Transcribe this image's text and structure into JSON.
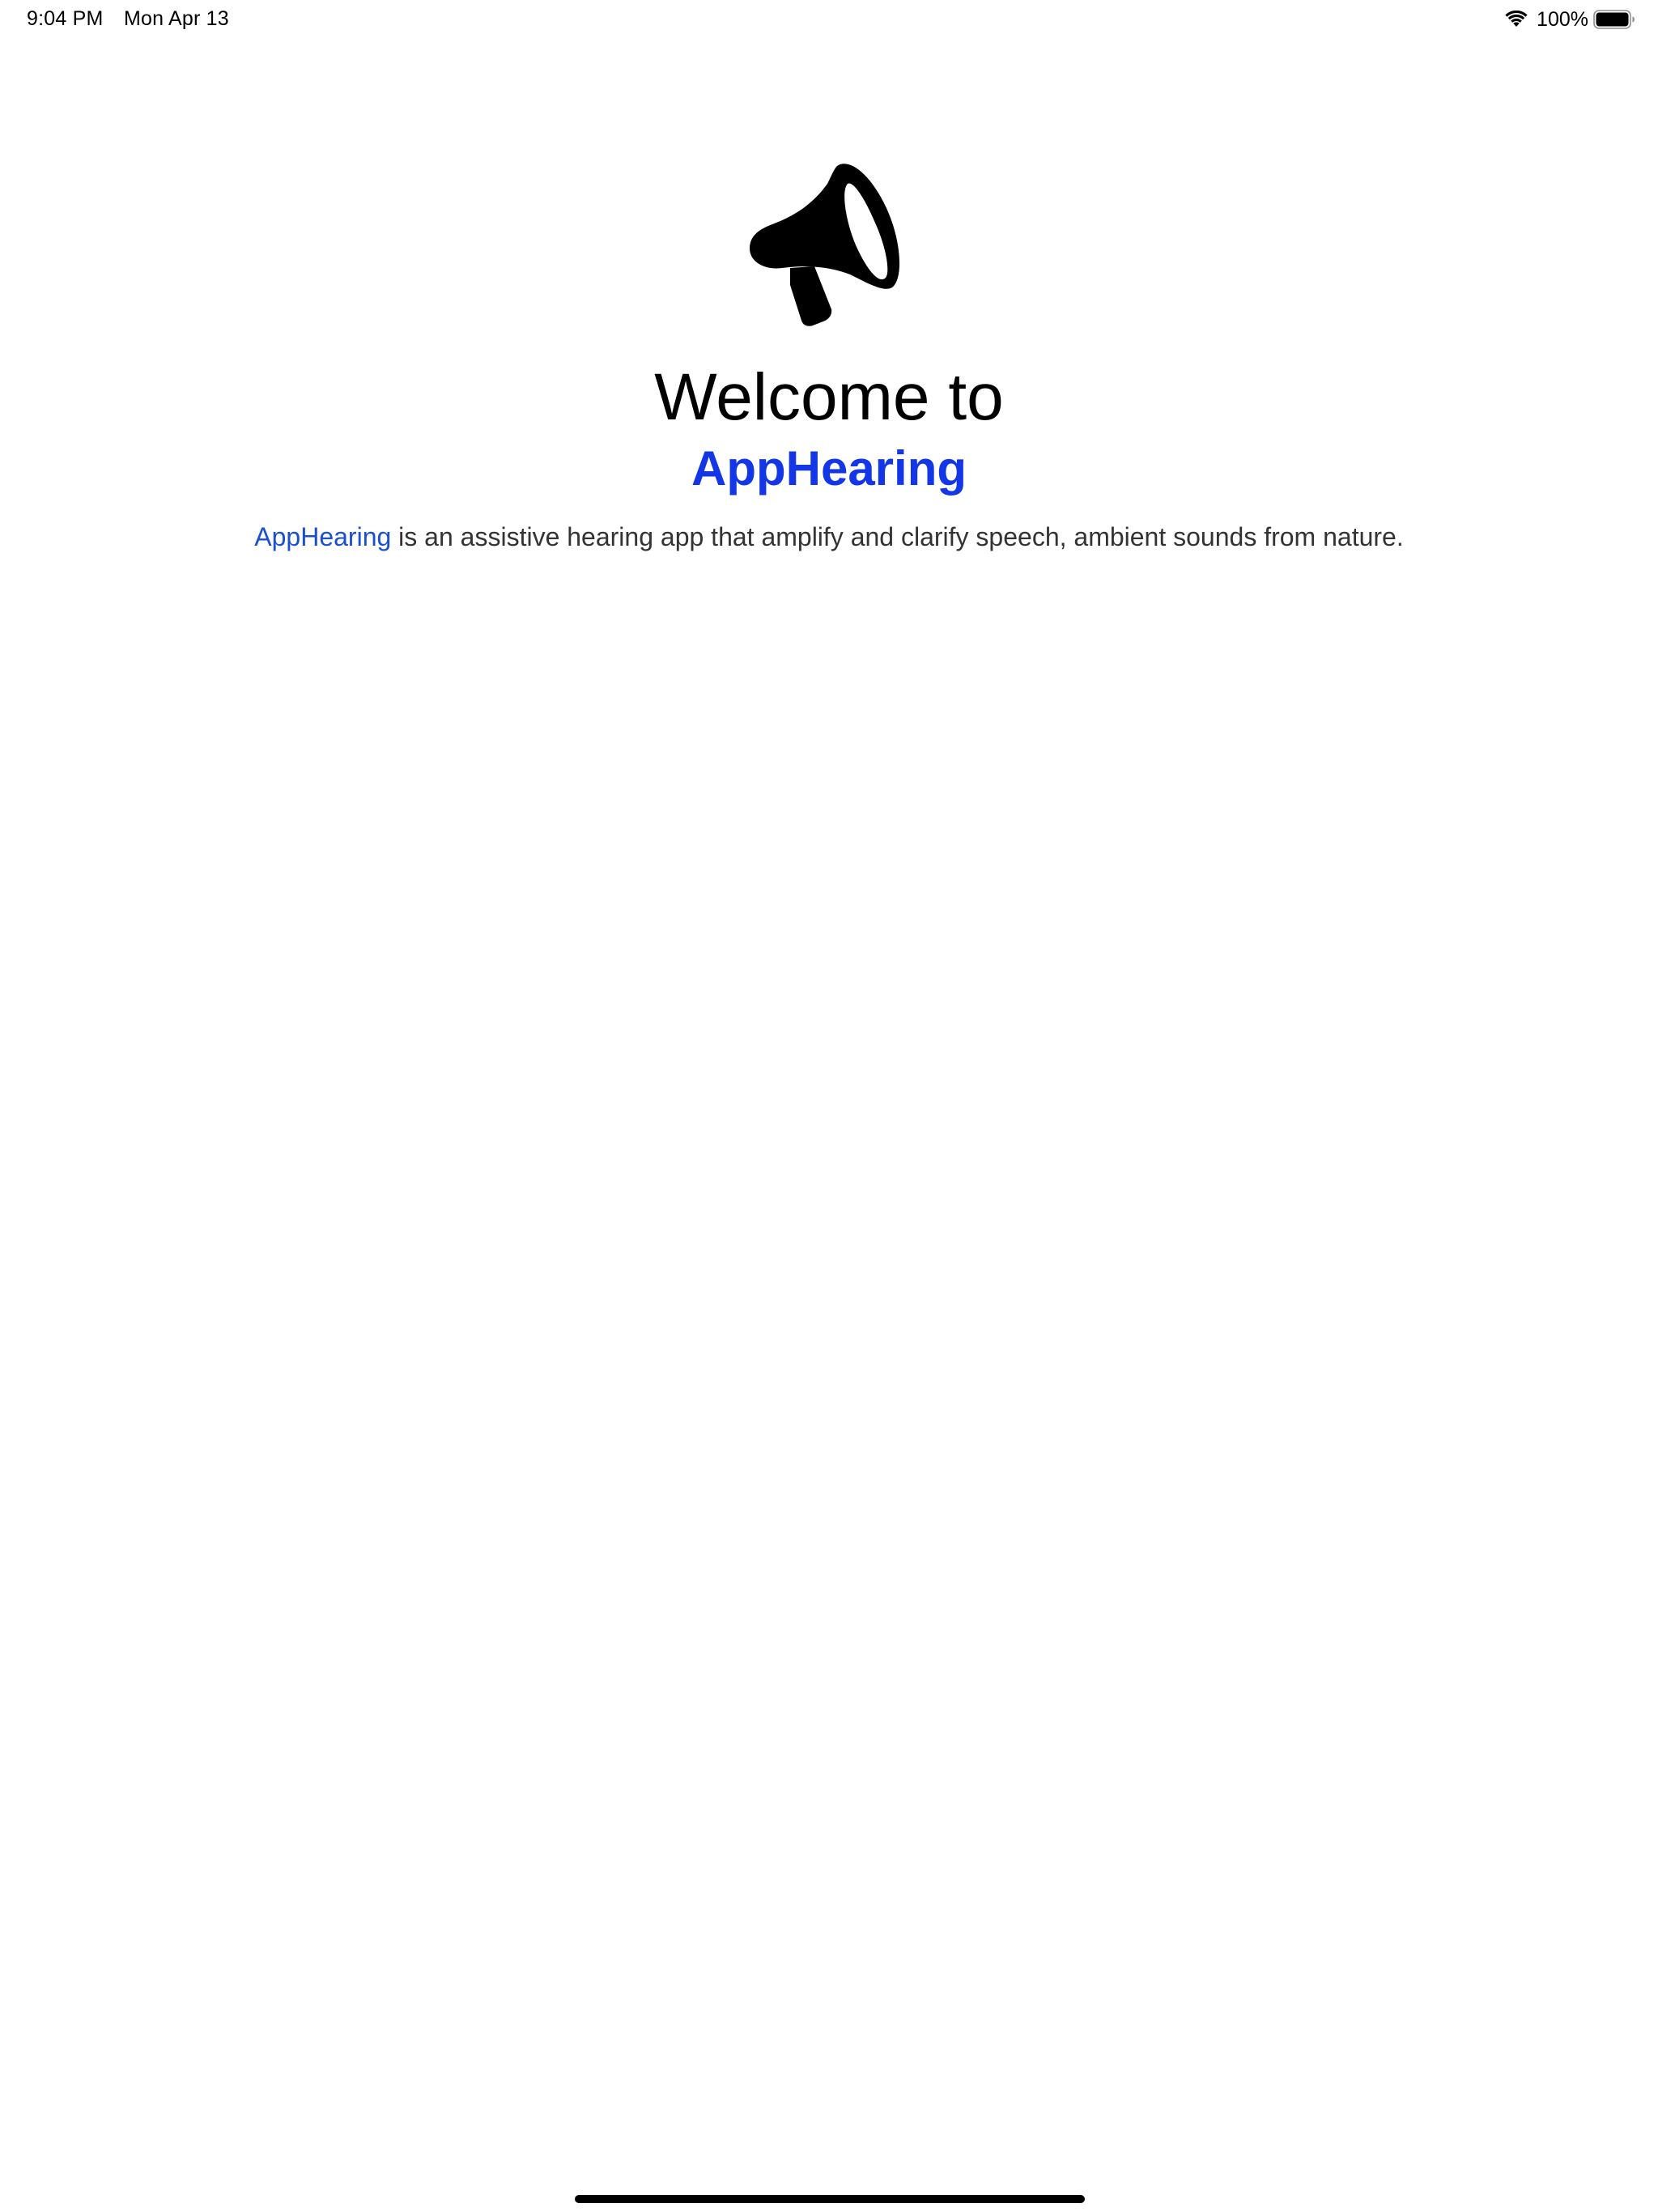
{
  "status_bar": {
    "time": "9:04 PM",
    "date": "Mon Apr 13",
    "battery_percent": "100%",
    "icons": [
      "wifi-icon",
      "battery-icon"
    ]
  },
  "welcome": {
    "icon": "megaphone-icon",
    "title": "Welcome to",
    "app_name": "AppHearing",
    "description_app_name": "AppHearing",
    "description_text": " is an assistive hearing app that amplify and clarify speech, ambient sounds from nature."
  },
  "colors": {
    "accent": "#1337e6",
    "link": "#1a4fcf",
    "text": "#333333",
    "background": "#ffffff"
  }
}
